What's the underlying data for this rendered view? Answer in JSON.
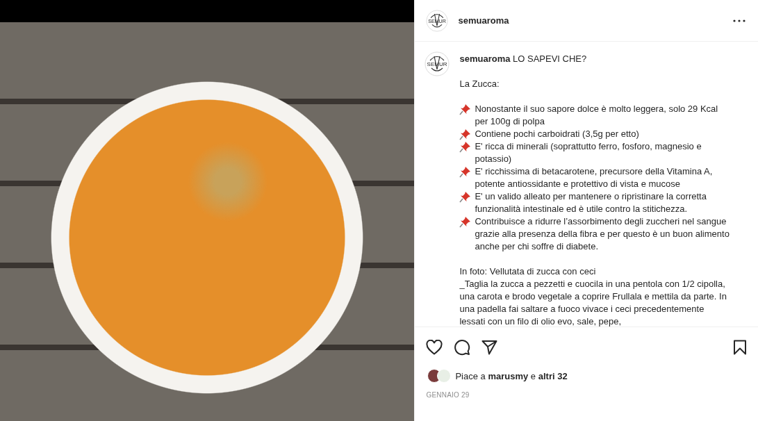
{
  "header": {
    "username": "semuaroma",
    "avatar_text": "SEMUR"
  },
  "caption": {
    "avatar_text": "SEMUR",
    "username": "semuaroma",
    "title": "LO SAPEVI CHE?",
    "intro": "La Zucca:",
    "bullets": [
      {
        "text": "Nonostante il suo sapore dolce è molto leggera, solo 29 Kcal per 100g di polpa"
      },
      {
        "text": "Contiene pochi carboidrati (3,5g per etto)"
      },
      {
        "text": "E' ricca di minerali (soprattutto ferro, fosforo, magnesio e potassio)"
      },
      {
        "text": "E' ricchissima di betacarotene, precursore della Vitamina A, potente antiossidante e protettivo di vista e mucose"
      },
      {
        "text": "E' un valido alleato per mantenere o ripristinare la corretta funzionalità intestinale ed è utile contro la stitichezza."
      },
      {
        "text": "Contribuisce a ridurre l’assorbimento degli zuccheri nel sangue grazie alla presenza della fibra e per questo è un buon alimento anche per chi soffre di diabete."
      }
    ],
    "photo_caption": "In foto: Vellutata di zucca con ceci",
    "recipe": "_Taglia la zucca a pezzetti e cuocila in una pentola con 1/2 cipolla, una carota e brodo vegetale a coprire Frullala e mettila da parte. In una padella fai saltare a fuoco vivace i ceci precedentemente lessati con un filo di olio evo, sale, pepe,"
  },
  "likes": {
    "text": "Piace a **marusmy** e **altri 32**"
  },
  "date": "GENNAIO 29"
}
